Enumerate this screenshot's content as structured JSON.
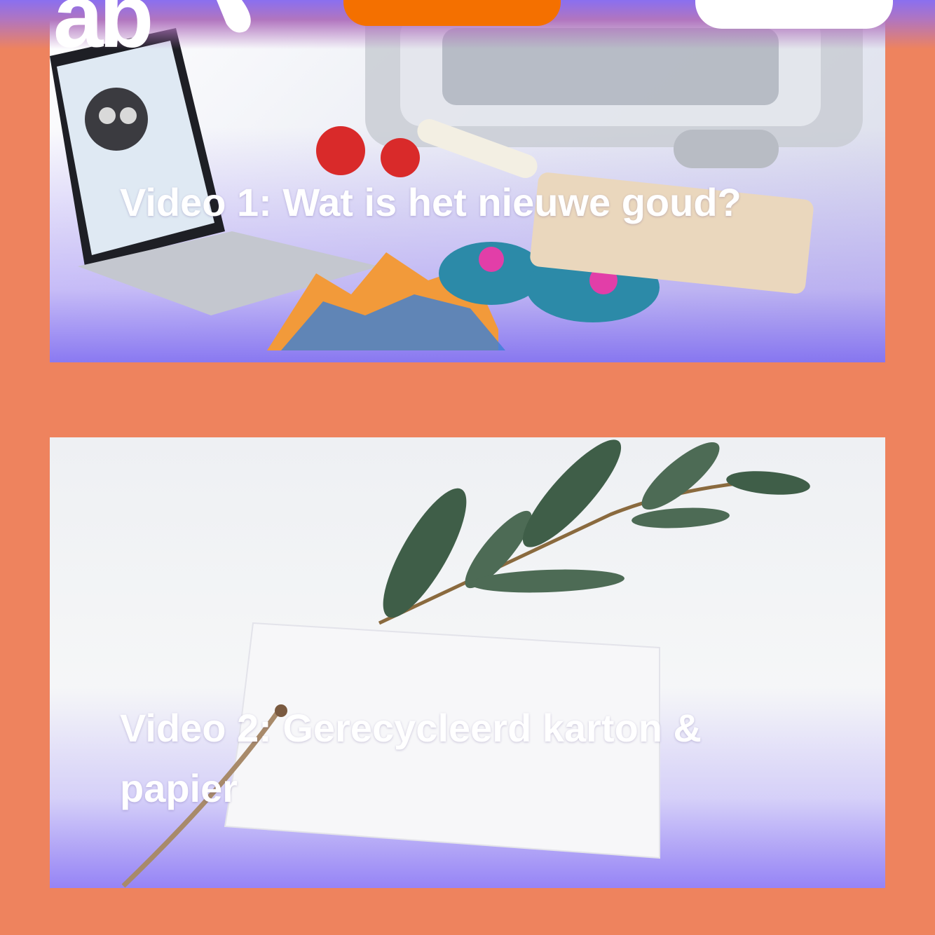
{
  "header": {
    "logo_text": "ab",
    "colors": {
      "cta": "#f47000",
      "page_bg": "#ee835e",
      "overlay": "#8a6ff0"
    }
  },
  "videos": [
    {
      "title": "Video 1: Wat is het nieuwe goud?",
      "image": "3d-printed-objects-and-laptop"
    },
    {
      "title": "Video 2: Gerecycleerd karton & papier",
      "image": "eucalyptus-branch-on-paper-tag"
    }
  ]
}
